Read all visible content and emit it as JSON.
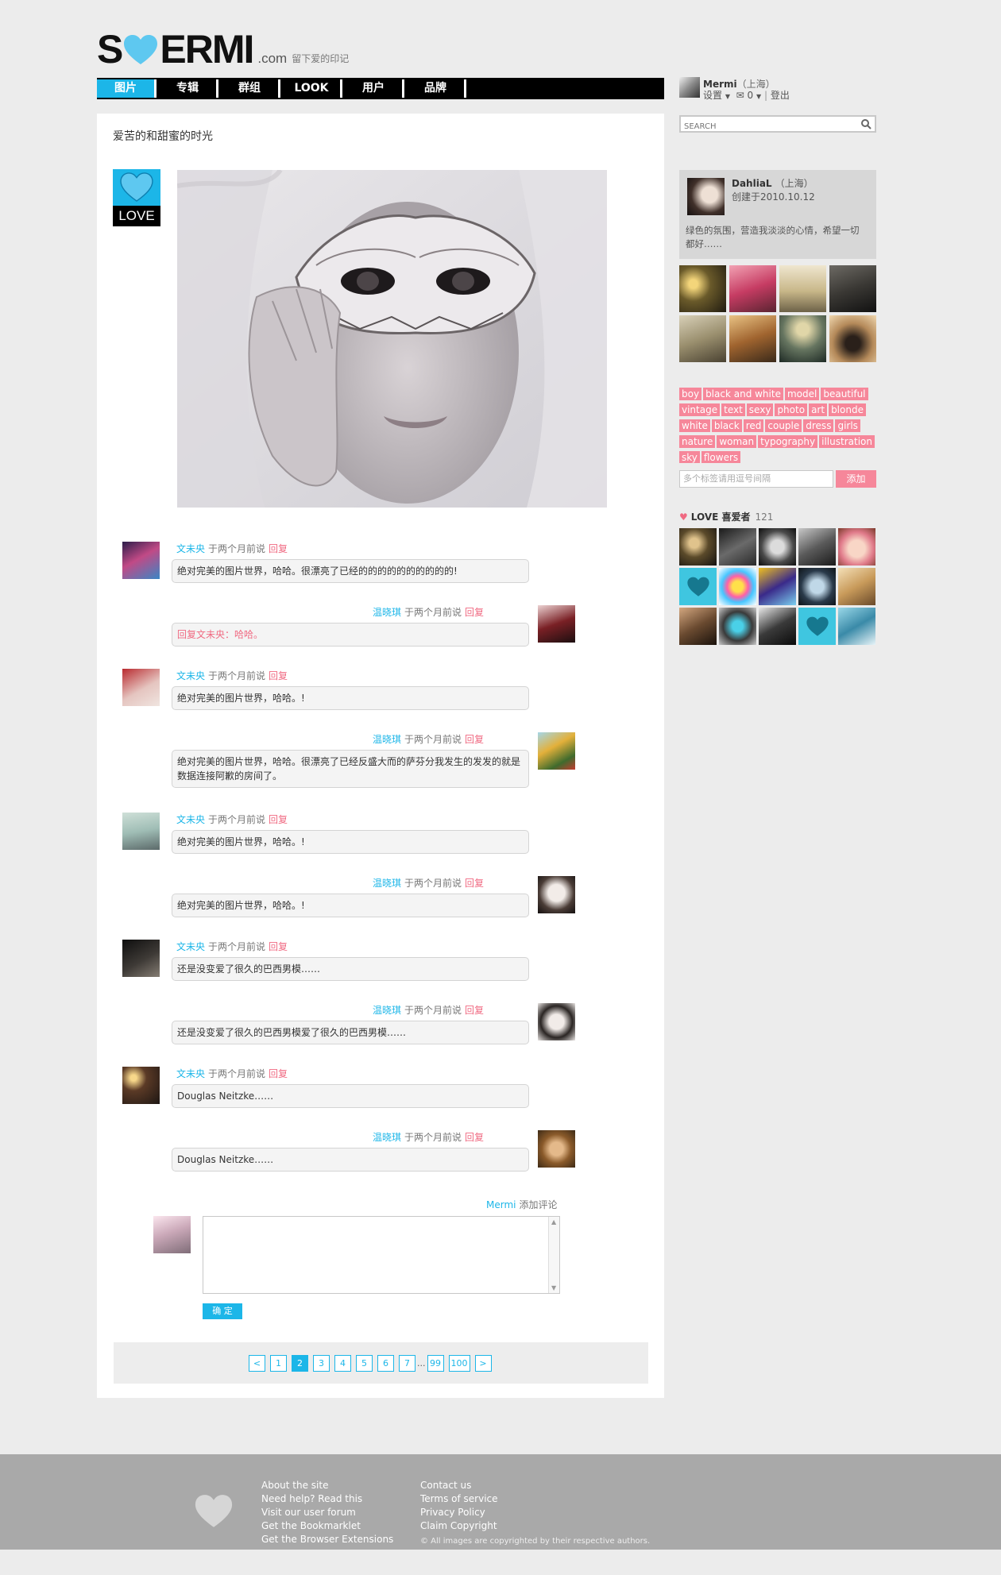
{
  "header": {
    "logo_s": "S",
    "logo_rest": "ERMI",
    "logo_com": ".com",
    "tagline": "留下爱的印记"
  },
  "nav": {
    "items": [
      "图片",
      "专辑",
      "群组",
      "LOOK",
      "用户",
      "品牌"
    ],
    "active": 0
  },
  "userbar": {
    "name": "Mermi",
    "location": "（上海）",
    "settings": "设置",
    "messages": "0",
    "logout": "登出"
  },
  "search": {
    "placeholder": "SEARCH"
  },
  "post": {
    "title": "爱苦的和甜蜜的时光",
    "badge": "LOVE"
  },
  "comments": [
    {
      "side": "left",
      "name": "文未央",
      "time": "于两个月前说",
      "reply": "回复",
      "text": "绝对完美的图片世界，哈哈。很漂亮了已经的的的的的的的的的的!"
    },
    {
      "side": "right",
      "name": "温晓琪",
      "time": "于两个月前说",
      "reply": "回复",
      "text": "回复文未央：哈哈。",
      "red": true
    },
    {
      "side": "left",
      "name": "文未央",
      "time": "于两个月前说",
      "reply": "回复",
      "text": "绝对完美的图片世界，哈哈。!"
    },
    {
      "side": "right",
      "name": "温晓琪",
      "time": "于两个月前说",
      "reply": "回复",
      "text": "绝对完美的图片世界，哈哈。很漂亮了已经反盛大而的萨芬分我发生的发发的就是数据连接阿歉的房间了。"
    },
    {
      "side": "left",
      "name": "文未央",
      "time": "于两个月前说",
      "reply": "回复",
      "text": "绝对完美的图片世界，哈哈。!"
    },
    {
      "side": "right",
      "name": "温晓琪",
      "time": "于两个月前说",
      "reply": "回复",
      "text": "绝对完美的图片世界，哈哈。!"
    },
    {
      "side": "left",
      "name": "文未央",
      "time": "于两个月前说",
      "reply": "回复",
      "text": "还是没变爱了很久的巴西男模……"
    },
    {
      "side": "right",
      "name": "温晓琪",
      "time": "于两个月前说",
      "reply": "回复",
      "text": "还是没变爱了很久的巴西男模爱了很久的巴西男模……"
    },
    {
      "side": "left",
      "name": "文未央",
      "time": "于两个月前说",
      "reply": "回复",
      "text": "Douglas Neitzke……"
    },
    {
      "side": "right",
      "name": "温晓琪",
      "time": "于两个月前说",
      "reply": "回复",
      "text": "Douglas Neitzke……"
    }
  ],
  "new_comment": {
    "name": "Mermi",
    "add": "添加评论",
    "submit": "确 定"
  },
  "pager": {
    "prev": "<",
    "pages": [
      "1",
      "2",
      "3",
      "4",
      "5",
      "6",
      "7"
    ],
    "dots": "...",
    "tail": [
      "99",
      "100"
    ],
    "next": ">",
    "current": "2"
  },
  "profile": {
    "name": "DahliaL",
    "location": "（上海）",
    "created": "创建于2010.10.12",
    "desc": "绿色的氛围，营造我淡淡的心情，希望一切都好……"
  },
  "tags": [
    "boy",
    "black and white",
    "model",
    "beautiful",
    "vintage",
    "text",
    "sexy",
    "photo",
    "art",
    "blonde",
    "white",
    "black",
    "red",
    "couple",
    "dress",
    "girls",
    "nature",
    "woman",
    "typography",
    "illustration",
    "sky",
    "flowers"
  ],
  "tag_input": {
    "placeholder": "多个标签请用逗号间隔",
    "add": "添加"
  },
  "lovers": {
    "title": "LOVE 喜爱者",
    "count": "121"
  },
  "footer": {
    "col1": [
      "About the site",
      "Need help? Read this",
      "Visit our user forum",
      "Get the Bookmarklet",
      "Get the Browser Extensions"
    ],
    "col2": [
      "Contact us",
      "Terms of service",
      "Privacy Policy",
      "Claim Copyright"
    ],
    "copyright": "© All images are copyrighted by their respective authors."
  },
  "colors": {
    "accent": "#1cb6e8",
    "pink": "#f6879a",
    "reply": "#f06a82"
  }
}
